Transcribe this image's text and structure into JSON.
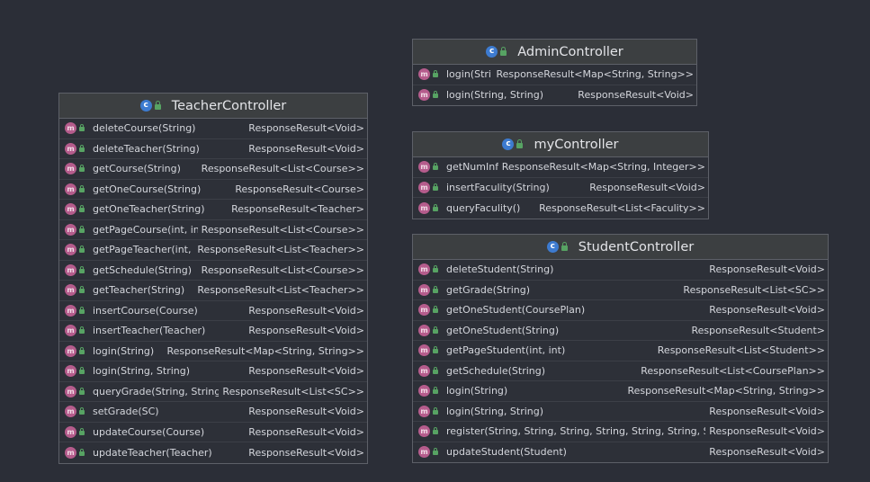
{
  "diagram": {
    "classes": {
      "teacher": {
        "name": "TeacherController",
        "icon": "class-icon",
        "members": [
          {
            "sig": "deleteCourse(String)",
            "ret": "ResponseResult<Void>"
          },
          {
            "sig": "deleteTeacher(String)",
            "ret": "ResponseResult<Void>"
          },
          {
            "sig": "getCourse(String)",
            "ret": "ResponseResult<List<Course>>"
          },
          {
            "sig": "getOneCourse(String)",
            "ret": "ResponseResult<Course>"
          },
          {
            "sig": "getOneTeacher(String)",
            "ret": "ResponseResult<Teacher>"
          },
          {
            "sig": "getPageCourse(int, int)",
            "ret": "ResponseResult<List<Course>>"
          },
          {
            "sig": "getPageTeacher(int, int)",
            "ret": "ResponseResult<List<Teacher>>"
          },
          {
            "sig": "getSchedule(String)",
            "ret": "ResponseResult<List<Course>>"
          },
          {
            "sig": "getTeacher(String)",
            "ret": "ResponseResult<List<Teacher>>"
          },
          {
            "sig": "insertCourse(Course)",
            "ret": "ResponseResult<Void>"
          },
          {
            "sig": "insertTeacher(Teacher)",
            "ret": "ResponseResult<Void>"
          },
          {
            "sig": "login(String)",
            "ret": "ResponseResult<Map<String, String>>"
          },
          {
            "sig": "login(String, String)",
            "ret": "ResponseResult<Void>"
          },
          {
            "sig": "queryGrade(String, String)",
            "ret": "ResponseResult<List<SC>>"
          },
          {
            "sig": "setGrade(SC)",
            "ret": "ResponseResult<Void>"
          },
          {
            "sig": "updateCourse(Course)",
            "ret": "ResponseResult<Void>"
          },
          {
            "sig": "updateTeacher(Teacher)",
            "ret": "ResponseResult<Void>"
          }
        ]
      },
      "admin": {
        "name": "AdminController",
        "icon": "class-icon",
        "members": [
          {
            "sig": "login(String)",
            "ret": "ResponseResult<Map<String, String>>"
          },
          {
            "sig": "login(String, String)",
            "ret": "ResponseResult<Void>"
          }
        ]
      },
      "my": {
        "name": "myController",
        "icon": "class-icon",
        "members": [
          {
            "sig": "getNumInfo()",
            "ret": "ResponseResult<Map<String, Integer>>"
          },
          {
            "sig": "insertFaculity(String)",
            "ret": "ResponseResult<Void>"
          },
          {
            "sig": "queryFaculity()",
            "ret": "ResponseResult<List<Faculity>>"
          }
        ]
      },
      "student": {
        "name": "StudentController",
        "icon": "class-icon",
        "members": [
          {
            "sig": "deleteStudent(String)",
            "ret": "ResponseResult<Void>"
          },
          {
            "sig": "getGrade(String)",
            "ret": "ResponseResult<List<SC>>"
          },
          {
            "sig": "getOneStudent(CoursePlan)",
            "ret": "ResponseResult<Void>"
          },
          {
            "sig": "getOneStudent(String)",
            "ret": "ResponseResult<Student>"
          },
          {
            "sig": "getPageStudent(int, int)",
            "ret": "ResponseResult<List<Student>>"
          },
          {
            "sig": "getSchedule(String)",
            "ret": "ResponseResult<List<CoursePlan>>"
          },
          {
            "sig": "login(String)",
            "ret": "ResponseResult<Map<String, String>>"
          },
          {
            "sig": "login(String, String)",
            "ret": "ResponseResult<Void>"
          },
          {
            "sig": "register(String, String, String, String, String, String, String)",
            "ret": "ResponseResult<Void>"
          },
          {
            "sig": "updateStudent(Student)",
            "ret": "ResponseResult<Void>"
          }
        ]
      }
    },
    "colors": {
      "background": "#2b2e37",
      "header": "#3c3f41",
      "class_icon": "#3d7bd0",
      "method_icon": "#b55c8c",
      "public_lock": "#57a363"
    }
  }
}
